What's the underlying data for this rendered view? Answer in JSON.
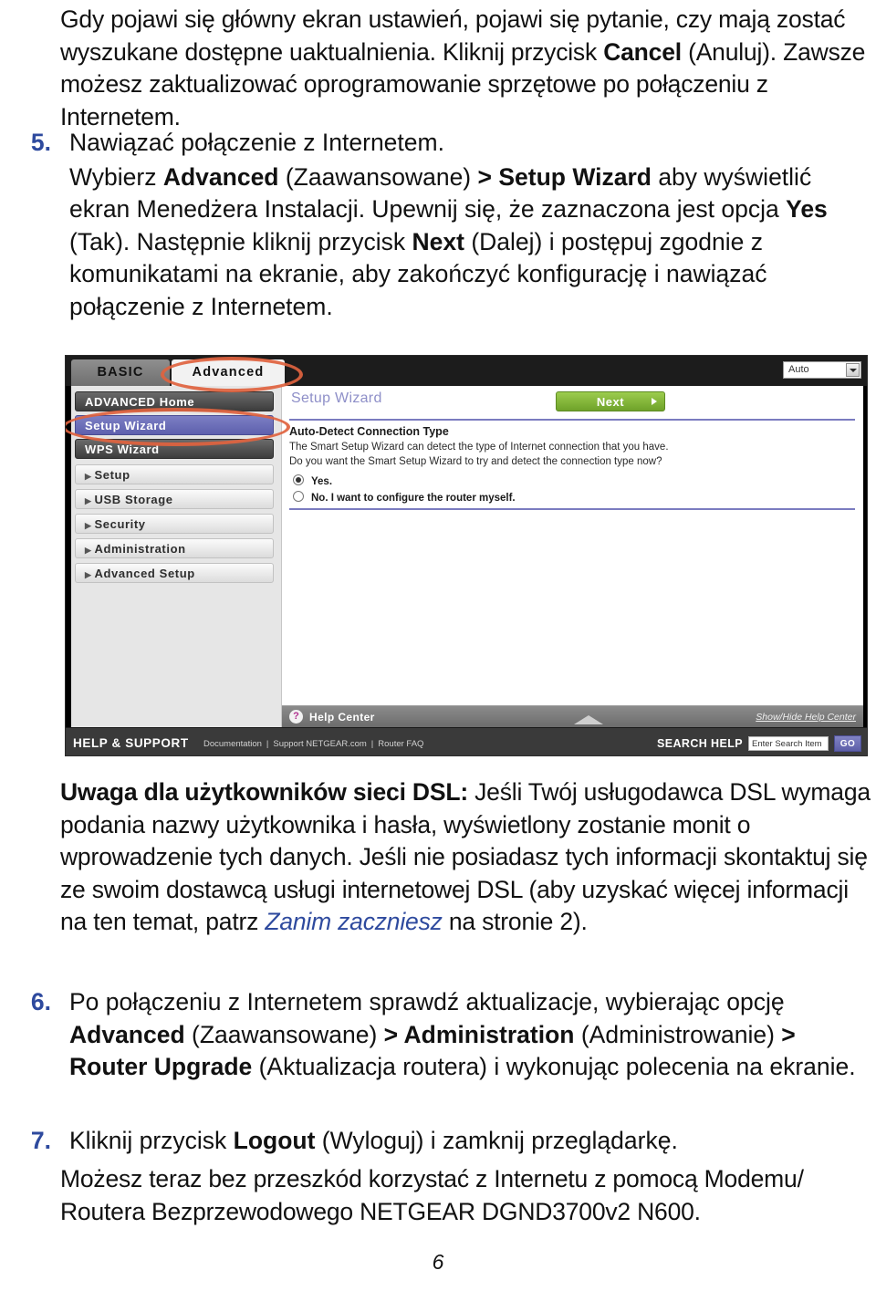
{
  "document": {
    "language": "pl",
    "page_number": "6",
    "accent_blue": "#2e4a9e",
    "annotation_color": "#e0633f"
  },
  "intro_paragraph": {
    "segments": [
      {
        "text": "Gdy pojawi się główny ekran ustawień, pojawi się pytanie, czy mają zostać wyszukane dostępne uaktualnienia. Kliknij przycisk ",
        "bold": false
      },
      {
        "text": "Cancel",
        "bold": true
      },
      {
        "text": " (Anuluj). Zawsze możesz zaktualizować oprogramowanie sprzętowe po połączeniu z Internetem.",
        "bold": false
      }
    ]
  },
  "steps": [
    {
      "number": "5.",
      "lines": [
        {
          "segments": [
            {
              "text": "Nawiązać połączenie z Internetem.",
              "bold": false
            }
          ]
        },
        {
          "segments": [
            {
              "text": "Wybierz ",
              "bold": false
            },
            {
              "text": "Advanced",
              "bold": true
            },
            {
              "text": " (Zaawansowane) ",
              "bold": false
            },
            {
              "text": "> Setup Wizard",
              "bold": true
            },
            {
              "text": " aby wyświetlić ekran Menedżera Instalacji. Upewnij się, że zaznaczona jest opcja ",
              "bold": false
            },
            {
              "text": "Yes",
              "bold": true
            },
            {
              "text": " (Tak). Następnie kliknij przycisk ",
              "bold": false
            },
            {
              "text": "Next",
              "bold": true
            },
            {
              "text": " (Dalej) i postępuj zgodnie z komunikatami na ekranie, aby zakończyć konfigurację i nawiązać połączenie z Internetem.",
              "bold": false
            }
          ]
        }
      ]
    },
    {
      "number": "6.",
      "lines": [
        {
          "segments": [
            {
              "text": "Po połączeniu z Internetem sprawdź aktualizacje, wybierając opcję ",
              "bold": false
            },
            {
              "text": "Advanced",
              "bold": true
            },
            {
              "text": " (Zaawansowane) ",
              "bold": false
            },
            {
              "text": "> Administration",
              "bold": true
            },
            {
              "text": " (Administrowanie) ",
              "bold": false
            },
            {
              "text": "> Router Upgrade",
              "bold": true
            },
            {
              "text": " (Aktualizacja routera) i wykonując polecenia na ekranie.",
              "bold": false
            }
          ]
        }
      ]
    },
    {
      "number": "7.",
      "lines": [
        {
          "segments": [
            {
              "text": "Kliknij przycisk ",
              "bold": false
            },
            {
              "text": "Logout",
              "bold": true
            },
            {
              "text": " (Wyloguj) i zamknij przeglądarkę.",
              "bold": false
            }
          ]
        }
      ]
    }
  ],
  "dsl_note": {
    "segments": [
      {
        "text": "Uwaga dla użytkowników sieci DSL:",
        "bold": true
      },
      {
        "text": " Jeśli Twój usługodawca DSL wymaga podania nazwy użytkownika i hasła, wyświetlony zostanie monit o wprowadzenie tych danych. Jeśli nie posiadasz tych informacji skontaktuj się ze swoim dostawcą usługi internetowej DSL (aby uzyskać więcej informacji na ten temat, patrz ",
        "bold": false
      },
      {
        "text": "Zanim zaczniesz",
        "bold": false,
        "link": true
      },
      {
        "text": " na stronie 2).",
        "bold": false
      }
    ]
  },
  "closing_paragraph": {
    "segments": [
      {
        "text": "Możesz teraz bez przeszkód korzystać z Internetu z pomocą Modemu/ Routera Bezprzewodowego NETGEAR DGND3700v2 N600.",
        "bold": false
      }
    ]
  },
  "router_screenshot": {
    "tabs": [
      {
        "label": "BASIC",
        "active": false
      },
      {
        "label": "Advanced",
        "active": true
      }
    ],
    "language_select": {
      "value": "Auto"
    },
    "sidebar": [
      {
        "label": "ADVANCED Home",
        "style": "dark"
      },
      {
        "label": "Setup Wizard",
        "style": "active"
      },
      {
        "label": "WPS Wizard",
        "style": "dark"
      },
      {
        "label": "Setup",
        "style": "light",
        "expandable": true
      },
      {
        "label": "USB Storage",
        "style": "light",
        "expandable": true
      },
      {
        "label": "Security",
        "style": "light",
        "expandable": true
      },
      {
        "label": "Administration",
        "style": "light",
        "expandable": true
      },
      {
        "label": "Advanced Setup",
        "style": "light",
        "expandable": true
      }
    ],
    "main": {
      "page_title": "Setup Wizard",
      "next_button": "Next",
      "section_title": "Auto-Detect Connection Type",
      "description_line1": "The Smart Setup Wizard can detect the type of Internet connection that you have.",
      "description_line2": "Do you want the Smart Setup Wizard to try and detect the connection type now?",
      "options": [
        {
          "label": "Yes.",
          "selected": true
        },
        {
          "label": "No. I want to configure the router myself.",
          "selected": false
        }
      ]
    },
    "help_bar": {
      "icon_glyph": "?",
      "label": "Help Center",
      "toggle_link": "Show/Hide Help Center"
    },
    "footer": {
      "title": "HELP & SUPPORT",
      "links": [
        "Documentation",
        "Support NETGEAR.com",
        "Router FAQ"
      ],
      "search_label": "SEARCH HELP",
      "search_placeholder": "Enter Search Item",
      "go_button": "GO"
    },
    "annotations": [
      {
        "target": "Advanced tab"
      },
      {
        "target": "Setup Wizard sidebar item"
      }
    ]
  }
}
